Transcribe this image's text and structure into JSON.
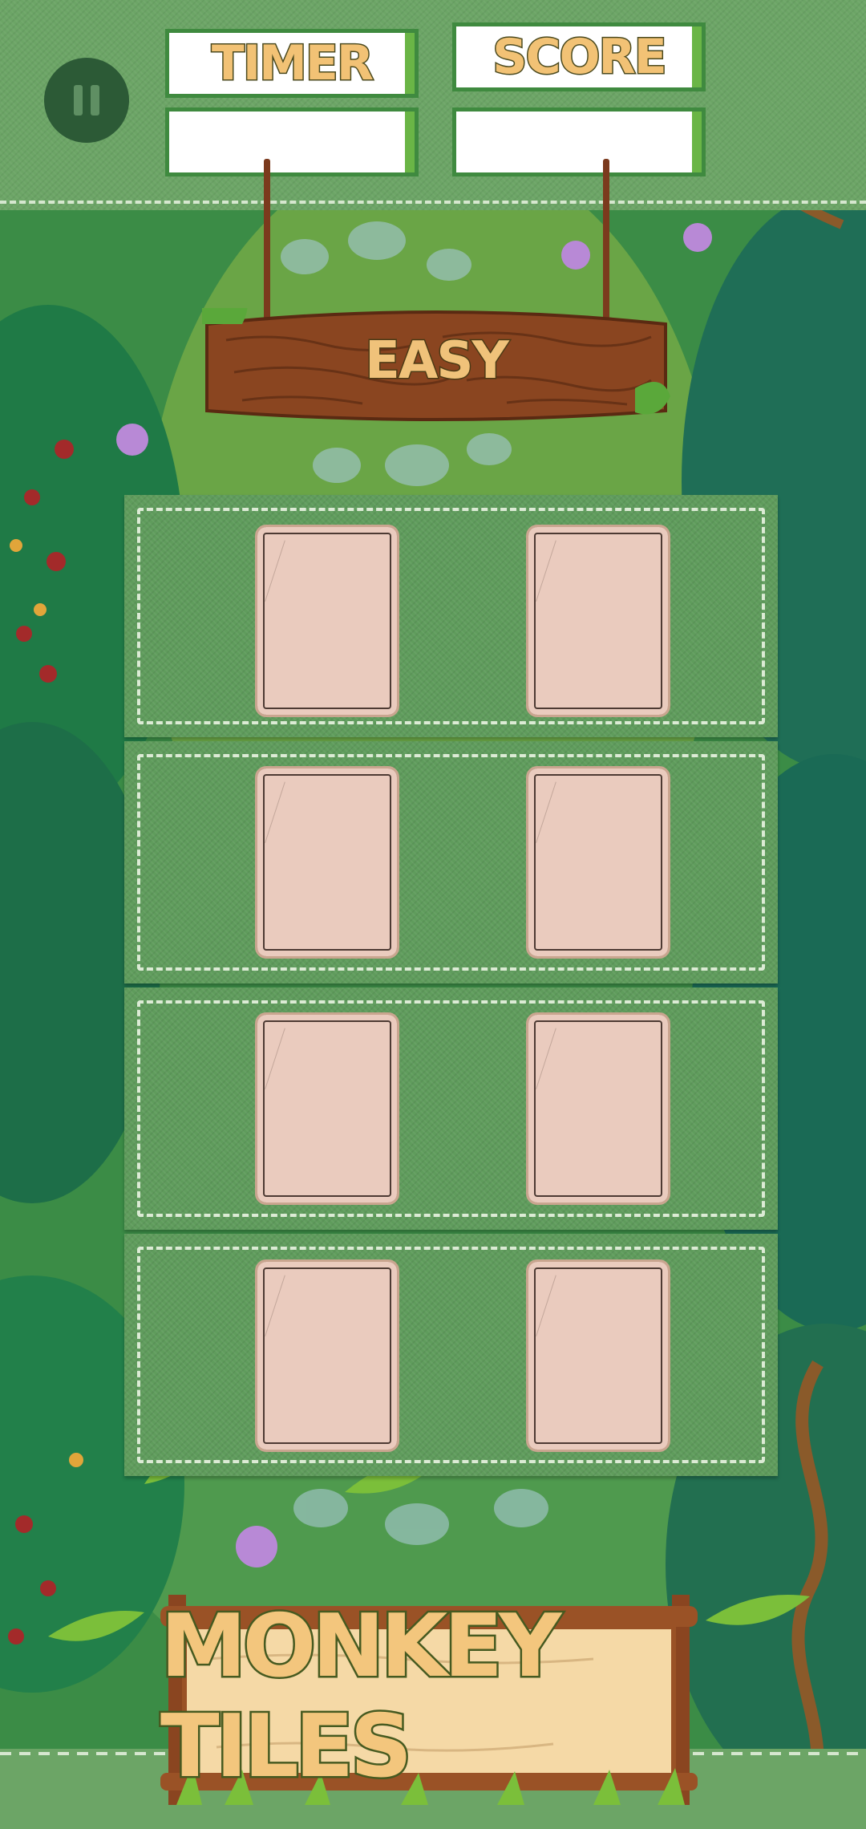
{
  "hud": {
    "timer_label": "TIMER",
    "timer_value": "",
    "score_label": "SCORE",
    "score_value": ""
  },
  "level": {
    "label": "EASY"
  },
  "board": {
    "rows": 4,
    "columns": 2,
    "tiles": [
      "face-down",
      "face-down",
      "face-down",
      "face-down",
      "face-down",
      "face-down",
      "face-down",
      "face-down"
    ]
  },
  "footer": {
    "title": "MONKEY TILES"
  },
  "colors": {
    "panel_border": "#3f8a3f",
    "label_fill": "#f2c275",
    "tile_back": "#eacbbe",
    "wood": "#8a4520",
    "felt": "#5f9c5c"
  },
  "icons": {
    "pause": "pause-icon"
  }
}
